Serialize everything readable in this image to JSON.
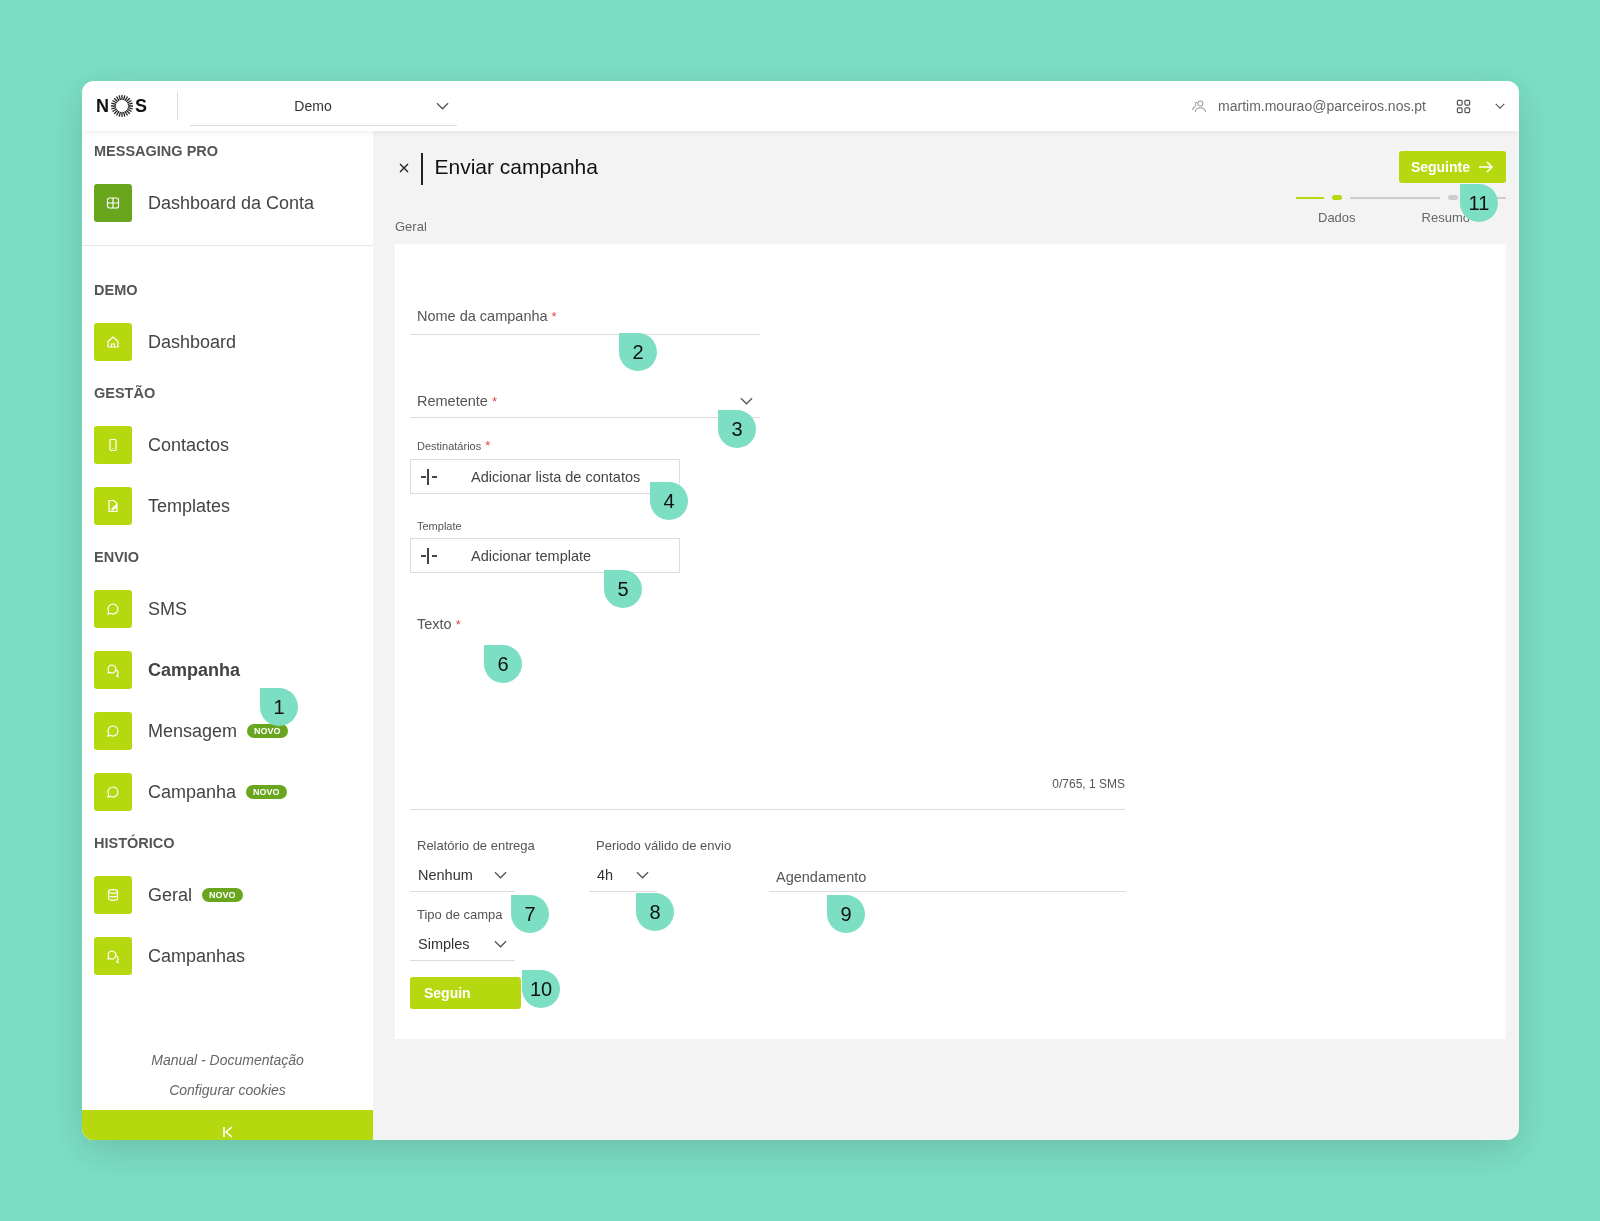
{
  "header": {
    "logo": {
      "left": "N",
      "right": "S"
    },
    "account_select": {
      "value": "Demo"
    },
    "user_email": "martim.mourao@parceiros.nos.pt"
  },
  "sidebar": {
    "sections": [
      {
        "title": "MESSAGING PRO",
        "items": [
          {
            "label": "Dashboard da Conta",
            "kind": "grid",
            "color": "#6aa51e",
            "selected": false
          }
        ]
      },
      {
        "title": "DEMO",
        "items": [
          {
            "label": "Dashboard",
            "kind": "home",
            "color": "#b5d80f",
            "selected": false
          }
        ]
      },
      {
        "title": "GESTÃO",
        "items": [
          {
            "label": "Contactos",
            "kind": "phone",
            "color": "#b5d80f",
            "selected": false
          },
          {
            "label": "Templates",
            "kind": "edit",
            "color": "#b5d80f",
            "selected": false
          }
        ]
      },
      {
        "title": "ENVIO",
        "items": [
          {
            "label": "SMS",
            "kind": "chat",
            "color": "#b5d80f",
            "selected": false
          },
          {
            "label": "Campanha",
            "kind": "chats",
            "color": "#b5d80f",
            "selected": true
          },
          {
            "label": "Mensagem",
            "kind": "chat",
            "color": "#b5d80f",
            "selected": false,
            "badge": "NOVO"
          },
          {
            "label": "Campanha",
            "kind": "chat",
            "color": "#b5d80f",
            "selected": false,
            "badge": "NOVO"
          }
        ]
      },
      {
        "title": "HISTÓRICO",
        "items": [
          {
            "label": "Geral",
            "kind": "database",
            "color": "#b5d80f",
            "selected": false,
            "badge": "NOVO"
          },
          {
            "label": "Campanhas",
            "kind": "chats",
            "color": "#b5d80f",
            "selected": false
          }
        ]
      }
    ],
    "footer_links": [
      "Manual - Documentação",
      "Configurar cookies"
    ]
  },
  "page": {
    "title": "Enviar campanha",
    "section": "Geral",
    "next_button": "Seguinte",
    "steps": [
      {
        "label": "Dados",
        "selected": true
      },
      {
        "label": "Resumo",
        "selected": false
      }
    ]
  },
  "form": {
    "campaign_name": {
      "label": "Nome da campanha",
      "required": true,
      "required_mark": "*"
    },
    "sender": {
      "label": "Remetente",
      "required": true,
      "required_mark": "*"
    },
    "recipients": {
      "label": "Destinatários",
      "required": true,
      "required_mark": "*",
      "button": "Adicionar lista de contatos"
    },
    "template": {
      "label": "Template",
      "button": "Adicionar template"
    },
    "text": {
      "label": "Texto",
      "required": true,
      "required_mark": "*",
      "counter": "0/765, 1 SMS"
    },
    "delivery_report": {
      "label": "Relatório de entrega",
      "value": "Nenhum"
    },
    "valid_period": {
      "label": "Periodo válido de envio",
      "value": "4h"
    },
    "schedule": {
      "placeholder": "Agendamento"
    },
    "campaign_type": {
      "label": "Tipo de campa",
      "value": "Simples"
    },
    "submit_button": "Seguin"
  },
  "callouts": [
    "1",
    "2",
    "3",
    "4",
    "5",
    "6",
    "7",
    "8",
    "9",
    "10",
    "11"
  ]
}
